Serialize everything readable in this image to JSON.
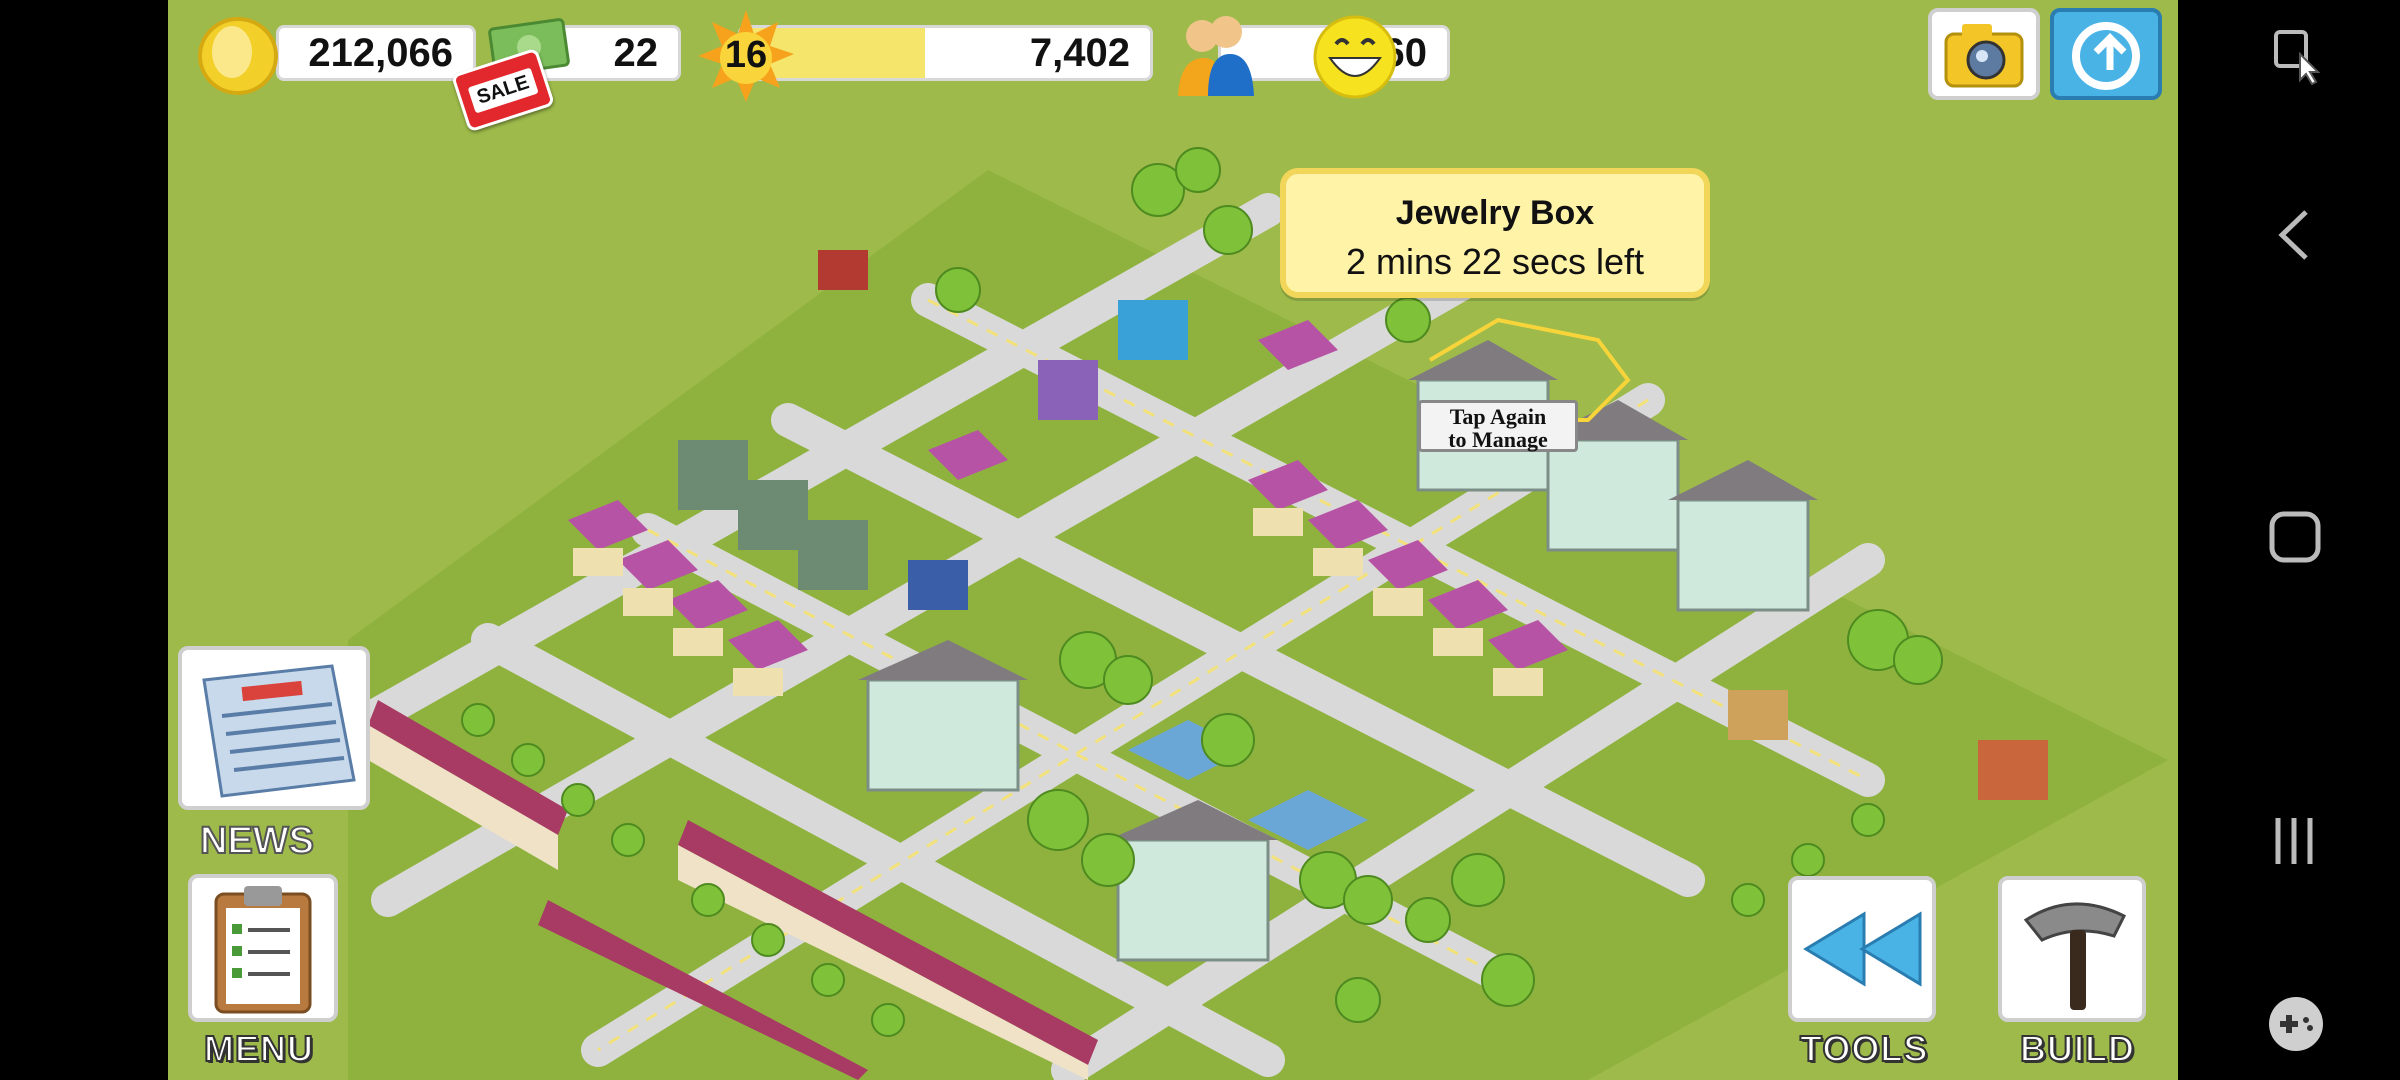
{
  "hud": {
    "coins": "212,066",
    "cash": "22",
    "sale_tag": "SALE",
    "level": "16",
    "xp": "7,402",
    "population": "8,160"
  },
  "tooltip": {
    "title": "Jewelry Box",
    "subtitle": "2 mins 22 secs left"
  },
  "map_label": {
    "line1": "Tap Again",
    "line2": "to Manage"
  },
  "buttons": {
    "news": "NEWS",
    "menu": "MENU",
    "tools": "TOOLS",
    "build": "BUILD"
  },
  "icons": {
    "coin": "coin-icon",
    "cash": "cash-icon",
    "xp": "star-icon",
    "population": "people-icon",
    "happiness": "smiley-icon",
    "camera": "camera-icon",
    "share": "share-icon",
    "newspaper": "newspaper-icon",
    "clipboard": "clipboard-icon",
    "rewind": "rewind-icon",
    "hammer": "hammer-icon"
  },
  "colors": {
    "grass": "#9dba4a",
    "road": "#d9d9d9",
    "tooltip_bg": "#fff3a8",
    "tooltip_border": "#f2d65a",
    "xp_bar": "#f6e56b",
    "share_button": "#4ab3e6"
  }
}
